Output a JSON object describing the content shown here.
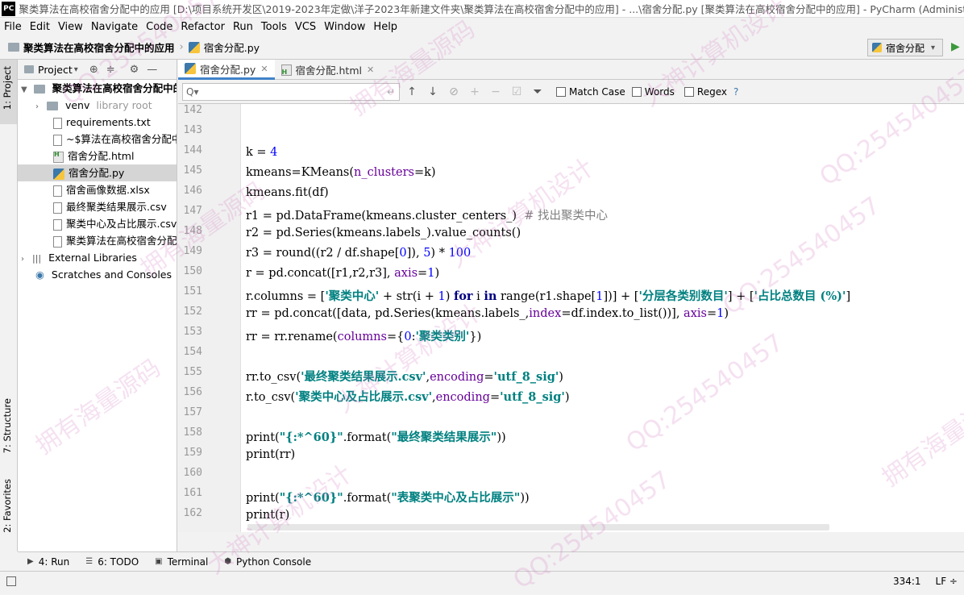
{
  "window": {
    "title": "聚类算法在高校宿舍分配中的应用 [D:\\项目系统开发区\\2019-2023年定做\\洋子2023年新建文件夹\\聚类算法在高校宿舍分配中的应用] - ...\\宿舍分配.py [聚类算法在高校宿舍分配中的应用] - PyCharm (Administrator)",
    "app_badge": "PC"
  },
  "menu": [
    "File",
    "Edit",
    "View",
    "Navigate",
    "Code",
    "Refactor",
    "Run",
    "Tools",
    "VCS",
    "Window",
    "Help"
  ],
  "nav": {
    "project": "聚类算法在高校宿舍分配中的应用",
    "file": "宿舍分配.py",
    "run_config": "宿舍分配"
  },
  "left_strip": {
    "project": "1: Project",
    "structure": "7: Structure",
    "favorites": "2: Favorites"
  },
  "project_panel": {
    "header": "Project",
    "root": "聚类算法在高校宿舍分配中的应用",
    "items": [
      {
        "label": "venv",
        "hint": "library root",
        "icon": "folder-icon"
      },
      {
        "label": "requirements.txt",
        "icon": "text-file-icon"
      },
      {
        "label": "~$算法在高校宿舍分配中的",
        "icon": "unknown-file-icon"
      },
      {
        "label": "宿舍分配.html",
        "icon": "html-file-icon"
      },
      {
        "label": "宿舍分配.py",
        "icon": "python-file-icon",
        "selected": true
      },
      {
        "label": "宿舍画像数据.xlsx",
        "icon": "unknown-file-icon"
      },
      {
        "label": "最终聚类结果展示.csv",
        "icon": "text-file-icon"
      },
      {
        "label": "聚类中心及占比展示.csv",
        "icon": "text-file-icon"
      },
      {
        "label": "聚类算法在高校宿舍分配中的",
        "icon": "unknown-file-icon"
      }
    ],
    "external": "External Libraries",
    "scratches": "Scratches and Consoles"
  },
  "editor_tabs": [
    {
      "label": "宿舍分配.py",
      "active": true
    },
    {
      "label": "宿舍分配.html",
      "active": false
    }
  ],
  "find": {
    "placeholder": "Q▾",
    "match_case": "Match Case",
    "words": "Words",
    "regex": "Regex",
    "help": "?"
  },
  "code": {
    "line_numbers": [
      "142",
      "143",
      "144",
      "145",
      "146",
      "147",
      "148",
      "149",
      "150",
      "151",
      "152",
      "153",
      "154",
      "155",
      "156",
      "157",
      "158",
      "159",
      "160",
      "161",
      "162"
    ]
  },
  "bottom_tabs": [
    "4: Run",
    "6: TODO",
    "Terminal",
    "Python Console"
  ],
  "status": {
    "position": "334:1",
    "line_sep": "LF ÷"
  },
  "watermarks": [
    "QQ:254540457",
    "拥有海量源码",
    "大神计算机设计"
  ]
}
